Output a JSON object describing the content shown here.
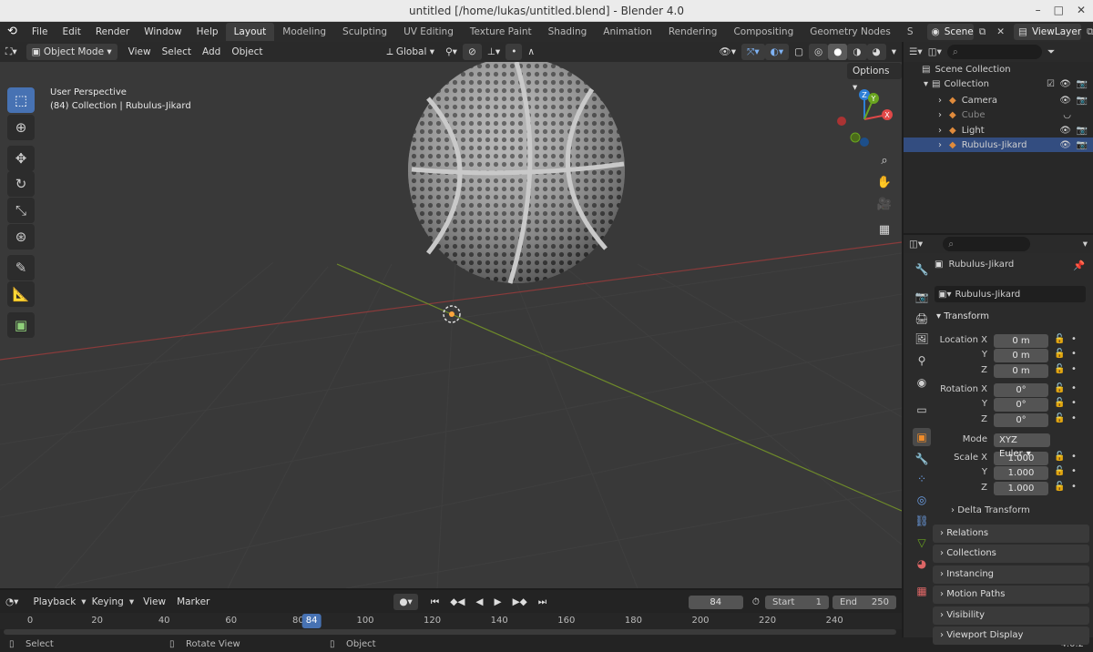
{
  "window": {
    "title": "untitled [/home/lukas/untitled.blend] - Blender 4.0",
    "controls": [
      "–",
      "□",
      "✕"
    ]
  },
  "menu": [
    "File",
    "Edit",
    "Render",
    "Window",
    "Help"
  ],
  "workspaces": [
    "Layout",
    "Modeling",
    "Sculpting",
    "UV Editing",
    "Texture Paint",
    "Shading",
    "Animation",
    "Rendering",
    "Compositing",
    "Geometry Nodes",
    "S"
  ],
  "scene": {
    "name": "Scene",
    "view_layer": "ViewLayer"
  },
  "viewport_header": {
    "mode": "Object Mode",
    "items": [
      "View",
      "Select",
      "Add",
      "Object"
    ],
    "transform_orientation": "Global",
    "options_label": "Options"
  },
  "viewport": {
    "perspective": "User Perspective",
    "info": "(84) Collection | Rubulus-Jikard"
  },
  "gizmo": {
    "x": "X",
    "y": "Y",
    "z": "Z"
  },
  "outliner": {
    "root": "Scene Collection",
    "collection": "Collection",
    "items": [
      {
        "name": "Camera",
        "icon": "camera-icon",
        "color": "#e08b3c"
      },
      {
        "name": "Cube",
        "icon": "mesh-icon",
        "color": "#e08b3c"
      },
      {
        "name": "Light",
        "icon": "light-icon",
        "color": "#e08b3c"
      },
      {
        "name": "Rubulus-Jikard",
        "icon": "mesh-icon",
        "color": "#e08b3c"
      }
    ]
  },
  "properties": {
    "object_name": "Rubulus-Jikard",
    "datablock": "Rubulus-Jikard",
    "transform_label": "Transform",
    "location_label": "Location X",
    "rotation_label": "Rotation X",
    "scale_label": "Scale X",
    "axis_y": "Y",
    "axis_z": "Z",
    "location": [
      "0 m",
      "0 m",
      "0 m"
    ],
    "rotation": [
      "0°",
      "0°",
      "0°"
    ],
    "mode_label": "Mode",
    "mode_value": "XYZ Euler",
    "scale": [
      "1.000",
      "1.000",
      "1.000"
    ],
    "delta": "Delta Transform",
    "panels": [
      "Relations",
      "Collections",
      "Instancing",
      "Motion Paths",
      "Visibility",
      "Viewport Display"
    ]
  },
  "timeline": {
    "menus": [
      "Playback",
      "Keying",
      "View",
      "Marker"
    ],
    "current_frame": "84",
    "start_label": "Start",
    "start": "1",
    "end_label": "End",
    "end": "250",
    "ticks": [
      "0",
      "20",
      "40",
      "60",
      "80",
      "100",
      "120",
      "140",
      "160",
      "180",
      "200",
      "220",
      "240"
    ],
    "playhead": "84"
  },
  "status": {
    "select": "Select",
    "rotate": "Rotate View",
    "object": "Object",
    "version": "4.0.2"
  }
}
